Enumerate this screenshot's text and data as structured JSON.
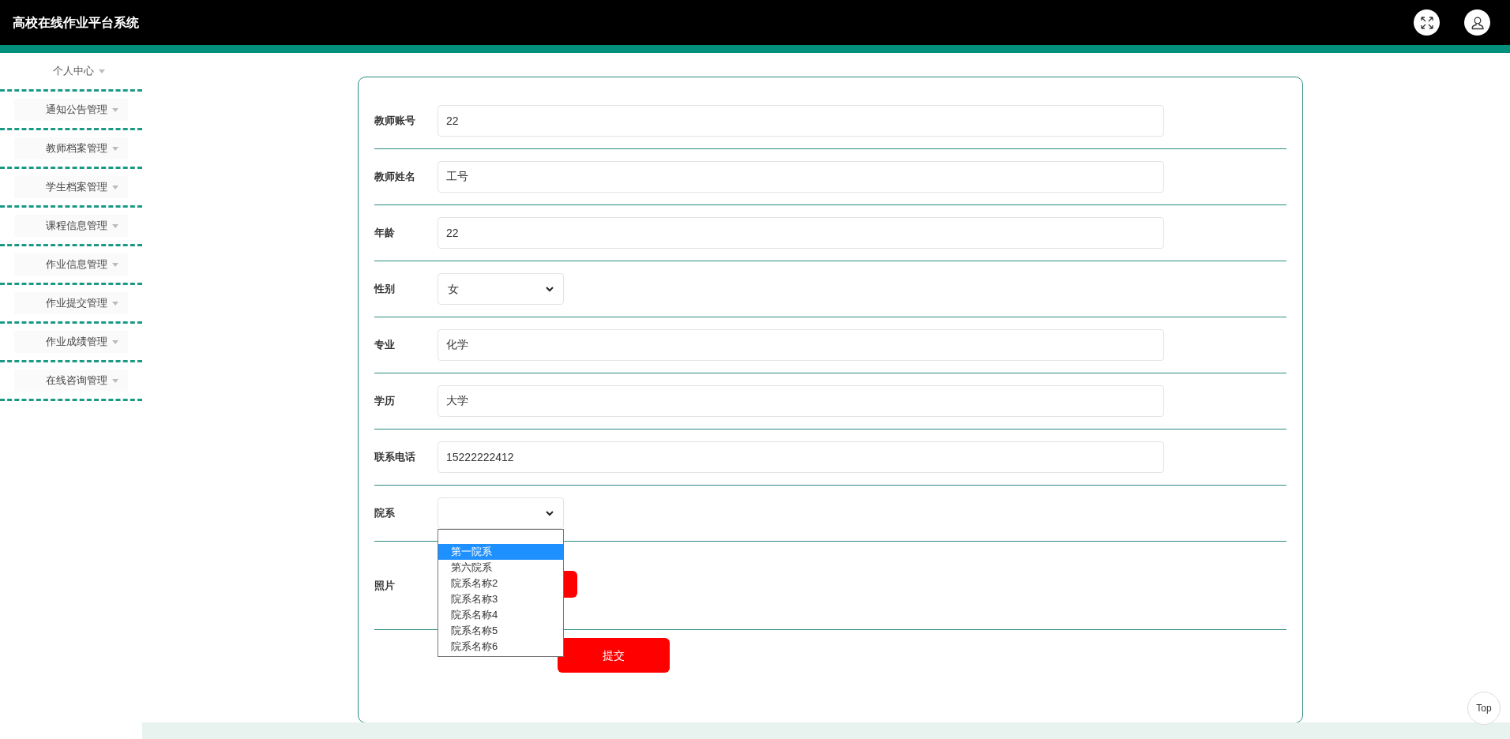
{
  "header": {
    "title": "高校在线作业平台系统"
  },
  "sidebar": {
    "items": [
      {
        "label": "个人中心",
        "selected": true
      },
      {
        "label": "通知公告管理",
        "selected": false
      },
      {
        "label": "教师档案管理",
        "selected": false
      },
      {
        "label": "学生档案管理",
        "selected": false
      },
      {
        "label": "课程信息管理",
        "selected": false
      },
      {
        "label": "作业信息管理",
        "selected": false
      },
      {
        "label": "作业提交管理",
        "selected": false
      },
      {
        "label": "作业成绩管理",
        "selected": false
      },
      {
        "label": "在线咨询管理",
        "selected": false
      }
    ]
  },
  "form": {
    "fields": [
      {
        "kind": "text",
        "label": "教师账号",
        "value": "22"
      },
      {
        "kind": "text",
        "label": "教师姓名",
        "value": "工号"
      },
      {
        "kind": "text",
        "label": "年龄",
        "value": "22"
      },
      {
        "kind": "select",
        "label": "性别",
        "value": "女"
      },
      {
        "kind": "text",
        "label": "专业",
        "value": "化学"
      },
      {
        "kind": "text",
        "label": "学历",
        "value": "大学"
      },
      {
        "kind": "text",
        "label": "联系电话",
        "value": "15222222412"
      },
      {
        "kind": "select",
        "label": "院系",
        "expanded": true,
        "options": [
          {
            "label": "第一院系",
            "selected": true
          },
          {
            "label": "第六院系",
            "selected": false
          },
          {
            "label": "院系名称2",
            "selected": false
          },
          {
            "label": "院系名称3",
            "selected": false
          },
          {
            "label": "院系名称4",
            "selected": false
          },
          {
            "label": "院系名称5",
            "selected": false
          },
          {
            "label": "院系名称6",
            "selected": false
          }
        ]
      },
      {
        "kind": "upload",
        "label": "照片"
      }
    ],
    "submit": "提交"
  },
  "back_to_top": "Top"
}
